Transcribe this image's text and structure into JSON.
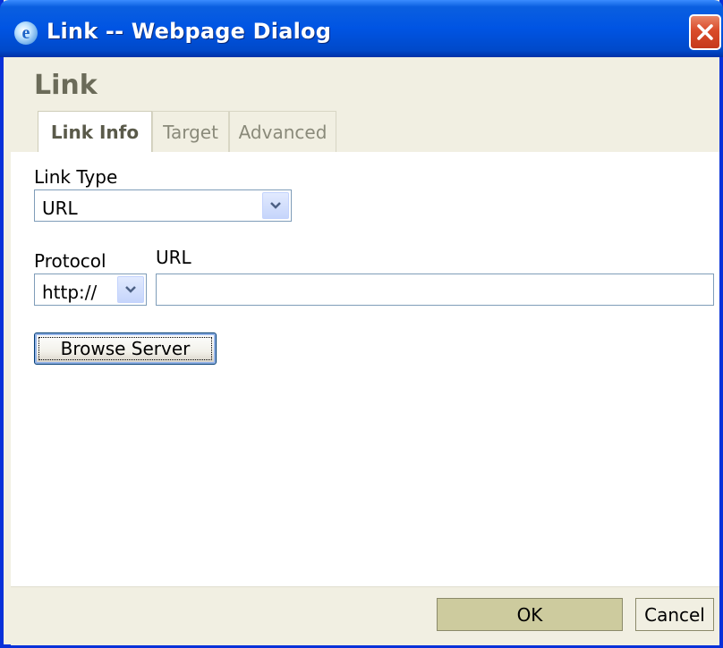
{
  "window": {
    "title": "Link -- Webpage Dialog",
    "icon": "ie-icon",
    "close_icon": "close-icon"
  },
  "dialog": {
    "title": "Link"
  },
  "tabs": [
    {
      "label": "Link Info",
      "active": true
    },
    {
      "label": "Target",
      "active": false
    },
    {
      "label": "Advanced",
      "active": false
    }
  ],
  "link_info": {
    "link_type_label": "Link Type",
    "link_type_value": "URL",
    "protocol_label": "Protocol",
    "protocol_value": "http://",
    "url_label": "URL",
    "url_value": "",
    "browse_label": "Browse Server"
  },
  "footer": {
    "ok_label": "OK",
    "cancel_label": "Cancel"
  },
  "colors": {
    "titlebar": "#0054e3",
    "dialog_bg": "#f1efe2",
    "close": "#d94b2a"
  }
}
